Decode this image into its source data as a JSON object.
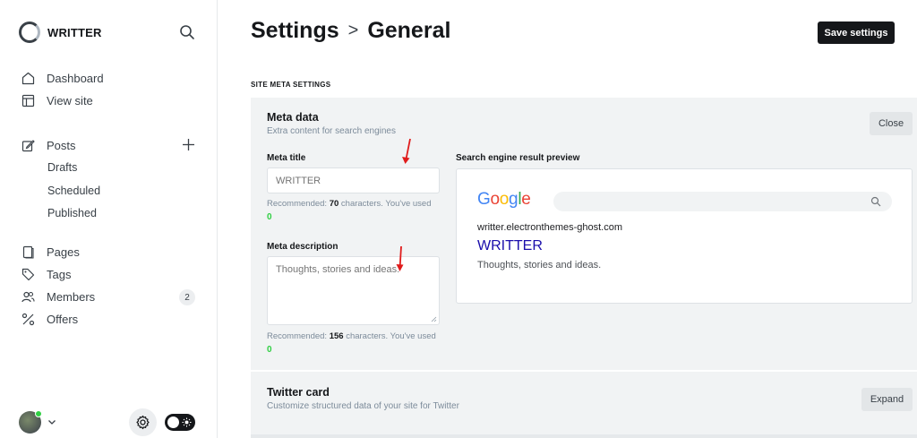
{
  "brand": {
    "name": "WRITTER"
  },
  "nav": {
    "dashboard": "Dashboard",
    "view_site": "View site",
    "posts": "Posts",
    "drafts": "Drafts",
    "scheduled": "Scheduled",
    "published": "Published",
    "pages": "Pages",
    "tags": "Tags",
    "members": "Members",
    "members_count": "2",
    "offers": "Offers"
  },
  "header": {
    "title_parent": "Settings",
    "separator": ">",
    "title_current": "General",
    "save_label": "Save settings"
  },
  "section": {
    "title": "SITE META SETTINGS"
  },
  "meta_panel": {
    "title": "Meta data",
    "subtitle": "Extra content for search engines",
    "close_label": "Close",
    "meta_title_label": "Meta title",
    "meta_title_placeholder": "WRITTER",
    "meta_title_hint_prefix": "Recommended: ",
    "meta_title_recommended": "70",
    "meta_title_hint_suffix": " characters. You've used",
    "meta_title_used": "0",
    "meta_desc_label": "Meta description",
    "meta_desc_placeholder": "Thoughts, stories and ideas.",
    "meta_desc_hint_prefix": "Recommended: ",
    "meta_desc_recommended": "156",
    "meta_desc_hint_suffix": " characters. You've used",
    "meta_desc_used": "0",
    "preview_label": "Search engine result preview",
    "preview": {
      "url": "writter.electronthemes-ghost.com",
      "title": "WRITTER",
      "description": "Thoughts, stories and ideas."
    }
  },
  "twitter_panel": {
    "title": "Twitter card",
    "subtitle": "Customize structured data of your site for Twitter",
    "expand_label": "Expand"
  },
  "colors": {
    "accent_dark": "#15171a",
    "success": "#30cf43",
    "annotation_arrow": "#e01b1b",
    "link_title": "#1a0dab"
  }
}
